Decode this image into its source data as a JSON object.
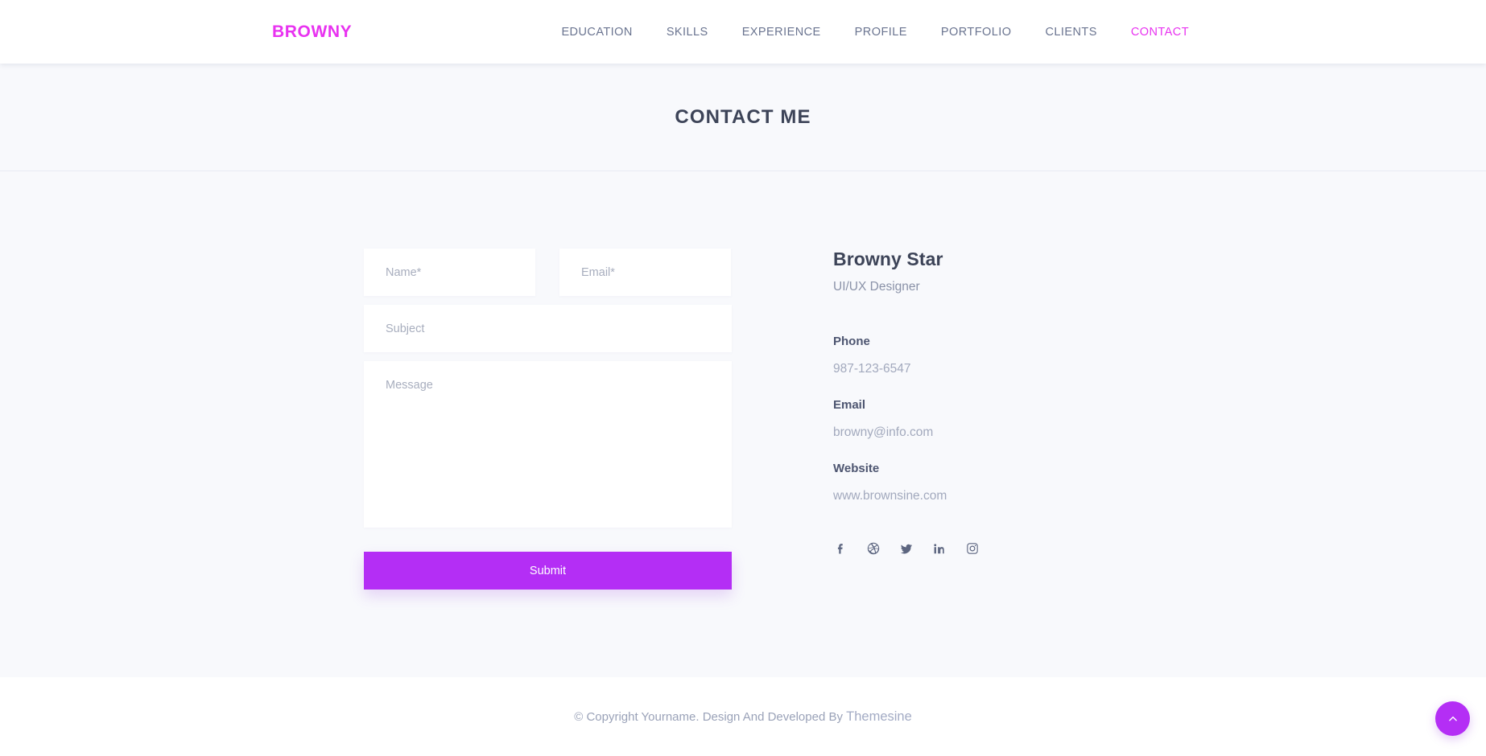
{
  "header": {
    "logo": "BROWNY",
    "nav": [
      {
        "label": "EDUCATION",
        "active": false
      },
      {
        "label": "SKILLS",
        "active": false
      },
      {
        "label": "EXPERIENCE",
        "active": false
      },
      {
        "label": "PROFILE",
        "active": false
      },
      {
        "label": "PORTFOLIO",
        "active": false
      },
      {
        "label": "CLIENTS",
        "active": false
      },
      {
        "label": "CONTACT",
        "active": true
      }
    ]
  },
  "page": {
    "title": "CONTACT ME"
  },
  "form": {
    "name_placeholder": "Name*",
    "name_value": "",
    "email_placeholder": "Email*",
    "email_value": "",
    "subject_placeholder": "Subject",
    "subject_value": "",
    "message_placeholder": "Message",
    "message_value": "",
    "submit_label": "Submit"
  },
  "info": {
    "name": "Browny Star",
    "role": "UI/UX Designer",
    "phone_label": "Phone",
    "phone_value": "987-123-6547",
    "email_label": "Email",
    "email_value": "browny@info.com",
    "website_label": "Website",
    "website_value": "www.brownsine.com",
    "social": [
      {
        "name": "facebook",
        "title": "Facebook"
      },
      {
        "name": "dribbble",
        "title": "Dribbble"
      },
      {
        "name": "twitter",
        "title": "Twitter"
      },
      {
        "name": "linkedin",
        "title": "LinkedIn"
      },
      {
        "name": "instagram",
        "title": "Instagram"
      }
    ]
  },
  "footer": {
    "copyright": "© Copyright Yourname. Design And Developed By ",
    "brand": "Themesine"
  },
  "scroll_top": {
    "icon": "chevron-up-icon"
  },
  "colors": {
    "accent": "#b42ef5",
    "brand": "#e832f0",
    "heading": "#3d4458",
    "body_text": "#5a6378",
    "muted_text": "#a2a9bd",
    "page_bg": "#f8f9fc",
    "surface": "#ffffff"
  }
}
